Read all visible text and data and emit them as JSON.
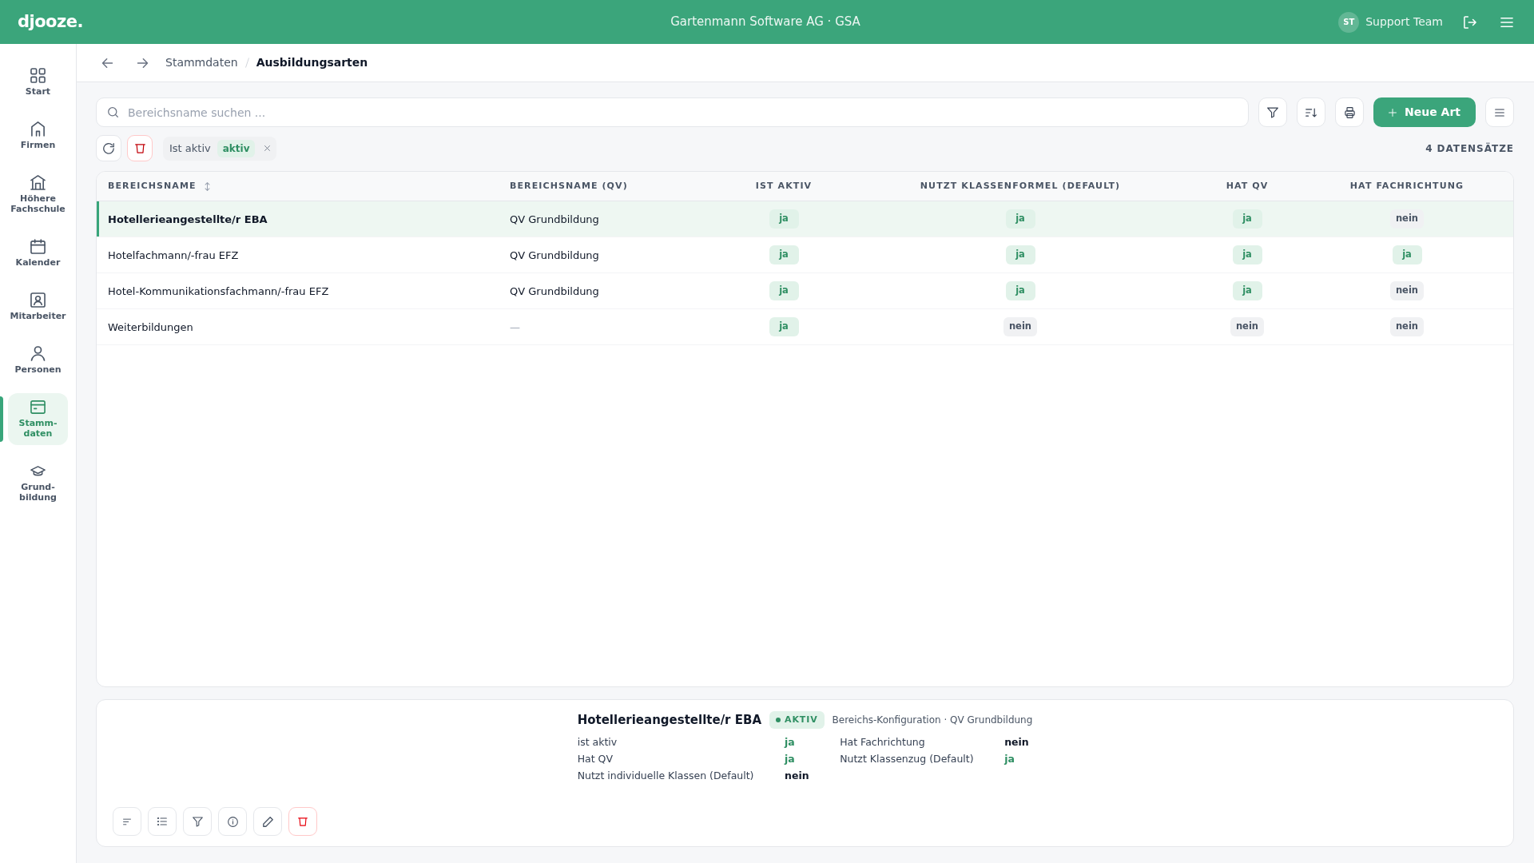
{
  "header": {
    "logo": "djooze.",
    "title": "Gartenmann Software AG · GSA",
    "user": {
      "initials": "ST",
      "name": "Support Team"
    }
  },
  "sidebar": {
    "items": [
      {
        "label": "Start",
        "selected": false
      },
      {
        "label": "Firmen",
        "selected": false
      },
      {
        "label": "Höhere Fachschule",
        "selected": false
      },
      {
        "label": "Kalender",
        "selected": false
      },
      {
        "label": "Mitarbeiter",
        "selected": false
      },
      {
        "label": "Personen",
        "selected": false
      },
      {
        "label": "Stamm-daten",
        "selected": true
      },
      {
        "label": "Grund-bildung",
        "selected": false
      }
    ]
  },
  "breadcrumb": {
    "items": [
      "Stammdaten",
      "Ausbildungsarten"
    ]
  },
  "toolbar": {
    "search": {
      "placeholder": "Bereichsname suchen ..."
    },
    "new_button": "Neue Art"
  },
  "filters": [
    {
      "label": "Ist aktiv",
      "value": "aktiv"
    }
  ],
  "record_count": "4 DATENSÄTZE",
  "table": {
    "columns": [
      {
        "label": "BEREICHSNAME",
        "kind": "text",
        "sortable": true
      },
      {
        "label": "BEREICHSNAME (QV)",
        "kind": "text",
        "sortable": false
      },
      {
        "label": "IST AKTIV",
        "kind": "flag",
        "sortable": false
      },
      {
        "label": "NUTZT KLASSENFORMEL (DEFAULT)",
        "kind": "flag",
        "sortable": false
      },
      {
        "label": "HAT QV",
        "kind": "flag",
        "sortable": false
      },
      {
        "label": "HAT FACHRICHTUNG",
        "kind": "flag",
        "sortable": false
      }
    ],
    "rows": [
      {
        "selected": true,
        "cells": [
          {
            "text": "Hotellerieangestellte/r EBA",
            "muted": false
          },
          {
            "text": "QV Grundbildung",
            "muted": false
          },
          {
            "text": "ja",
            "on": true
          },
          {
            "text": "ja",
            "on": true
          },
          {
            "text": "ja",
            "on": true
          },
          {
            "text": "nein",
            "on": false
          }
        ]
      },
      {
        "selected": false,
        "cells": [
          {
            "text": "Hotelfachmann/-frau EFZ",
            "muted": false
          },
          {
            "text": "QV Grundbildung",
            "muted": false
          },
          {
            "text": "ja",
            "on": true
          },
          {
            "text": "ja",
            "on": true
          },
          {
            "text": "ja",
            "on": true
          },
          {
            "text": "ja",
            "on": true
          }
        ]
      },
      {
        "selected": false,
        "cells": [
          {
            "text": "Hotel-Kommunikationsfachmann/-frau EFZ",
            "muted": false
          },
          {
            "text": "QV Grundbildung",
            "muted": false
          },
          {
            "text": "ja",
            "on": true
          },
          {
            "text": "ja",
            "on": true
          },
          {
            "text": "ja",
            "on": true
          },
          {
            "text": "nein",
            "on": false
          }
        ]
      },
      {
        "selected": false,
        "cells": [
          {
            "text": "Weiterbildungen",
            "muted": false
          },
          {
            "text": "—",
            "muted": true
          },
          {
            "text": "ja",
            "on": true
          },
          {
            "text": "nein",
            "on": false
          },
          {
            "text": "nein",
            "on": false
          },
          {
            "text": "nein",
            "on": false
          }
        ]
      }
    ]
  },
  "detail": {
    "title": "Hotellerieangestellte/r EBA",
    "status": {
      "label": "AKTIV",
      "on": true
    },
    "subtitle": "Bereichs-Konfiguration · QV Grundbildung",
    "fields": [
      {
        "label": "ist aktiv",
        "value": "ja",
        "on": true
      },
      {
        "label": "Hat Fachrichtung",
        "value": "nein",
        "on": false
      },
      {
        "label": "Hat QV",
        "value": "ja",
        "on": true
      },
      {
        "label": "Nutzt Klassenzug (Default)",
        "value": "ja",
        "on": true
      },
      {
        "label": "Nutzt individuelle Klassen (Default)",
        "value": "nein",
        "on": false
      }
    ]
  }
}
